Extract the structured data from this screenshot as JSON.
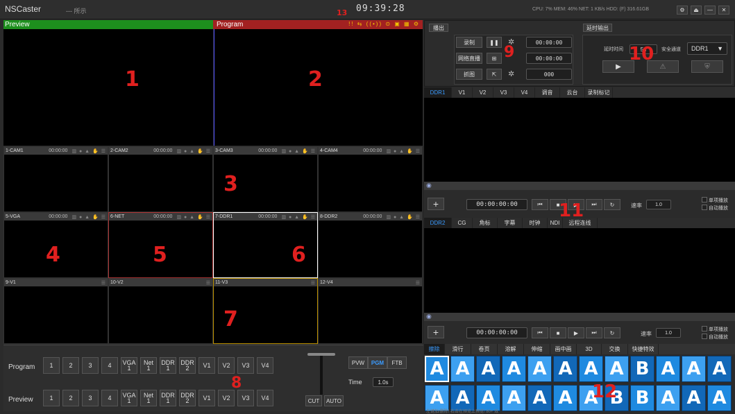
{
  "titlebar": {
    "app_name": "NSCaster",
    "subtitle": "--- 所示",
    "clock": "09:39:28",
    "stats": "CPU: 7%  MEM: 46%  NET: 1 KB/s  HDD: (F) 316.61GB"
  },
  "preview": {
    "label": "Preview",
    "overlay_number": "1"
  },
  "program": {
    "label": "Program",
    "overlay_number": "2"
  },
  "multiview": {
    "cells": [
      {
        "name": "1-CAM1",
        "time": "00:00:00"
      },
      {
        "name": "2-CAM2",
        "time": "00:00:00"
      },
      {
        "name": "3-CAM3",
        "time": "00:00:00"
      },
      {
        "name": "4-CAM4",
        "time": "00:00:00"
      },
      {
        "name": "5-VGA",
        "time": "00:00:00"
      },
      {
        "name": "6-NET",
        "time": "00:00:00"
      },
      {
        "name": "7-DDR1",
        "time": "00:00:00"
      },
      {
        "name": "8-DDR2",
        "time": "00:00:00"
      },
      {
        "name": "9-V1",
        "time": ""
      },
      {
        "name": "10-V2",
        "time": ""
      },
      {
        "name": "11-V3",
        "time": ""
      },
      {
        "name": "12-V4",
        "time": ""
      }
    ],
    "n3": "3",
    "n4": "4",
    "n5": "5",
    "n6": "6",
    "n7": "7"
  },
  "switcher": {
    "program_label": "Program",
    "preview_label": "Preview",
    "buttons": [
      {
        "top": "1",
        "bottom": ""
      },
      {
        "top": "2",
        "bottom": ""
      },
      {
        "top": "3",
        "bottom": ""
      },
      {
        "top": "4",
        "bottom": ""
      },
      {
        "top": "VGA",
        "bottom": "1"
      },
      {
        "top": "Net",
        "bottom": "1"
      },
      {
        "top": "DDR",
        "bottom": "1"
      },
      {
        "top": "DDR",
        "bottom": "2"
      },
      {
        "top": "V1",
        "bottom": ""
      },
      {
        "top": "V2",
        "bottom": ""
      },
      {
        "top": "V3",
        "bottom": ""
      },
      {
        "top": "V4",
        "bottom": ""
      }
    ],
    "pvw": "PVW",
    "pgm": "PGM",
    "ftb": "FTB",
    "time_label": "Time",
    "time_value": "1.0s",
    "cut": "CUT",
    "auto": "AUTO",
    "overlay_number": "8"
  },
  "output": {
    "broadcast_title": "播出",
    "record_label": "录制",
    "record_time": "00:00:00",
    "stream_label": "网络直播",
    "stream_time": "00:00:00",
    "snapshot_label": "抓图",
    "snapshot_count": "000",
    "overlay_number": "9"
  },
  "delay": {
    "title": "延时输出",
    "delay_time_label": "延时时间",
    "delay_time_value": "5s",
    "safe_channel_label": "安全通道",
    "safe_channel_value": "DDR1",
    "overlay_number": "10"
  },
  "media_tabs_top": [
    "DDR1",
    "V1",
    "V2",
    "V3",
    "V4",
    "调音",
    "云台",
    "录制标记"
  ],
  "media_tabs_bottom": [
    "DDR2",
    "CG",
    "角标",
    "字幕",
    "时钟",
    "NDI",
    "远程连线"
  ],
  "player1": {
    "timecode": "00:00:00:00",
    "speed_label": "速率",
    "speed": "1.0",
    "opt1": "单项播放",
    "opt2": "自动播放"
  },
  "player2": {
    "timecode": "00:00:00:00",
    "speed_label": "速率",
    "speed": "1.0",
    "opt1": "单项播放",
    "opt2": "自动播放"
  },
  "overlay_11": "11",
  "transitions": {
    "tabs": [
      "擦除",
      "滑行",
      "卷页",
      "溶解",
      "伸缩",
      "画中画",
      "3D",
      "交换",
      "快捷特效"
    ],
    "row1": [
      "A",
      "A",
      "A",
      "A",
      "A",
      "A",
      "A",
      "A",
      "B",
      "A",
      "A",
      "A"
    ],
    "row2": [
      "A",
      "A",
      "A",
      "A",
      "A",
      "A",
      "A",
      "B",
      "B",
      "A",
      "A",
      "A"
    ],
    "footer": "左键加/删除! 右击在预览上预览! 80+ 效",
    "overlay_number": "12"
  },
  "overlay_13": "13"
}
